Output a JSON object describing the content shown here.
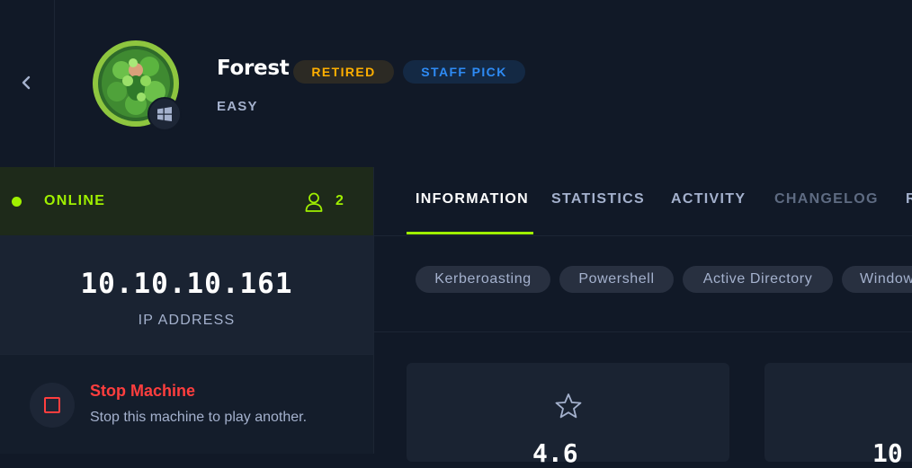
{
  "machine": {
    "name": "Forest",
    "difficulty": "EASY",
    "badges": {
      "retired": "RETIRED",
      "staff_pick": "STAFF PICK"
    },
    "os_icon": "windows-icon",
    "avatar_icon": "forest-avatar"
  },
  "nav": {
    "back_icon": "chevron-left-icon"
  },
  "status": {
    "label": "ONLINE",
    "users_icon": "user-icon",
    "user_count": "2"
  },
  "ip": {
    "value": "10.10.10.161",
    "label": "IP ADDRESS"
  },
  "stop": {
    "title": "Stop Machine",
    "description": "Stop this machine to play another."
  },
  "tabs": [
    {
      "label": "INFORMATION"
    },
    {
      "label": "STATISTICS"
    },
    {
      "label": "ACTIVITY"
    },
    {
      "label": "CHANGELOG"
    },
    {
      "label": "R"
    }
  ],
  "tags": [
    "Kerberoasting",
    "Powershell",
    "Active Directory",
    "Window"
  ],
  "cards": [
    {
      "icon": "star-icon",
      "value": "4.6"
    },
    {
      "value": "10"
    }
  ],
  "colors": {
    "accent": "#9fef00",
    "retired": "#ffaf00",
    "staff_pick": "#2e8bf5",
    "danger": "#ff3e3e",
    "background": "#111927"
  }
}
